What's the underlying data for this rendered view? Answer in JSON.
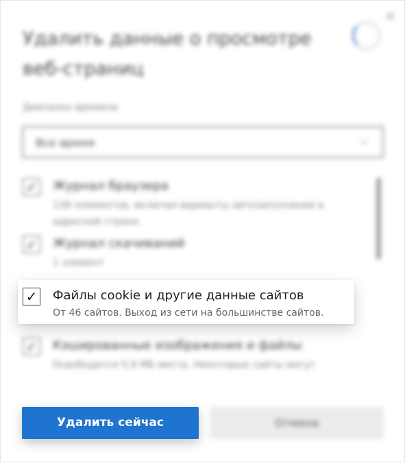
{
  "dialog": {
    "title": "Удалить данные о просмотре веб-страниц",
    "close_glyph": "×"
  },
  "time_range": {
    "label": "Диапазон времени",
    "selected": "Все время"
  },
  "options": [
    {
      "label": "Журнал браузера",
      "description": "138 элементов, включая варианты автозаполнения в адресной строке.",
      "checked": true
    },
    {
      "label": "Журнал скачиваний",
      "description": "1 элемент",
      "checked": true
    },
    {
      "label": "Файлы cookie и другие данные сайтов",
      "description": "От 46 сайтов. Выход из сети на большинстве сайтов.",
      "checked": true
    },
    {
      "label": "Кэшированные изображения и файлы",
      "description": "Освободится 5,9 МБ места. Некоторые сайты могут",
      "checked": true
    }
  ],
  "buttons": {
    "delete": "Удалить сейчас",
    "cancel": "Отмена"
  },
  "colors": {
    "accent": "#1f74cf"
  }
}
